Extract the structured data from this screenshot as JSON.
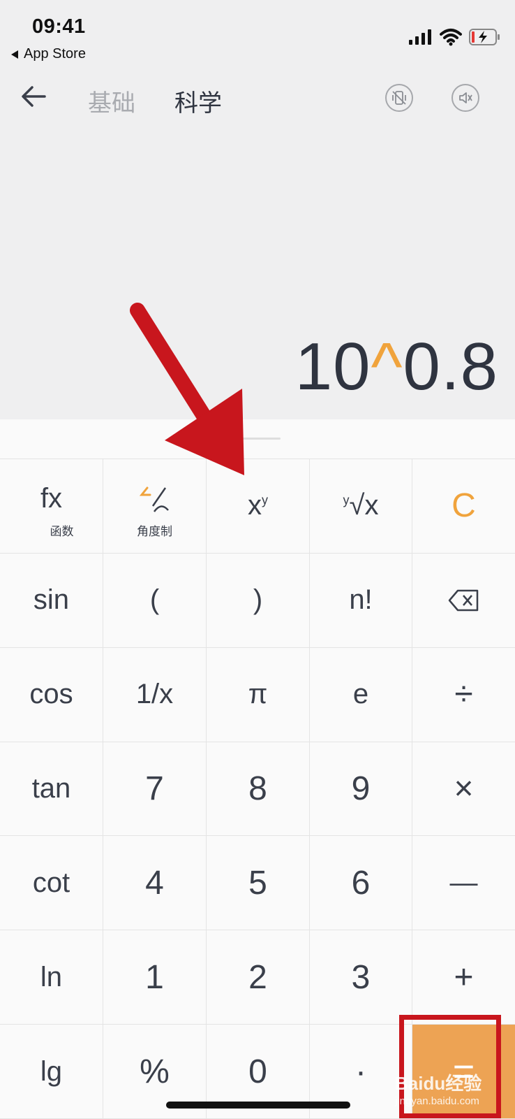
{
  "status_bar": {
    "time": "09:41",
    "back_app": "App Store"
  },
  "header": {
    "tabs": [
      {
        "label": "基础",
        "active": false
      },
      {
        "label": "科学",
        "active": true
      }
    ]
  },
  "display": {
    "base": "10",
    "operator": "^",
    "exponent": "0.8"
  },
  "keys": {
    "fx": "fx",
    "fx_sub": "函数",
    "angle_sub": "角度制",
    "power_base": "x",
    "power_exp": "y",
    "root_index": "y",
    "root_body": "√x",
    "clear": "C",
    "sin": "sin",
    "lparen": "(",
    "rparen": ")",
    "factorial": "n!",
    "cos": "cos",
    "reciprocal": "1/x",
    "pi": "π",
    "e": "e",
    "divide": "÷",
    "tan": "tan",
    "seven": "7",
    "eight": "8",
    "nine": "9",
    "multiply": "×",
    "cot": "cot",
    "four": "4",
    "five": "5",
    "six": "6",
    "minus": "—",
    "ln": "ln",
    "one": "1",
    "two": "2",
    "three": "3",
    "plus": "+",
    "lg": "lg",
    "percent": "%",
    "zero": "0",
    "dot": "·",
    "equals": "="
  },
  "watermark": {
    "brand": "Baidu经验",
    "url": "jingyan.baidu.com"
  },
  "colors": {
    "accent": "#f0a33c",
    "equals_bg": "#eda354",
    "annotation": "#c8161d"
  }
}
